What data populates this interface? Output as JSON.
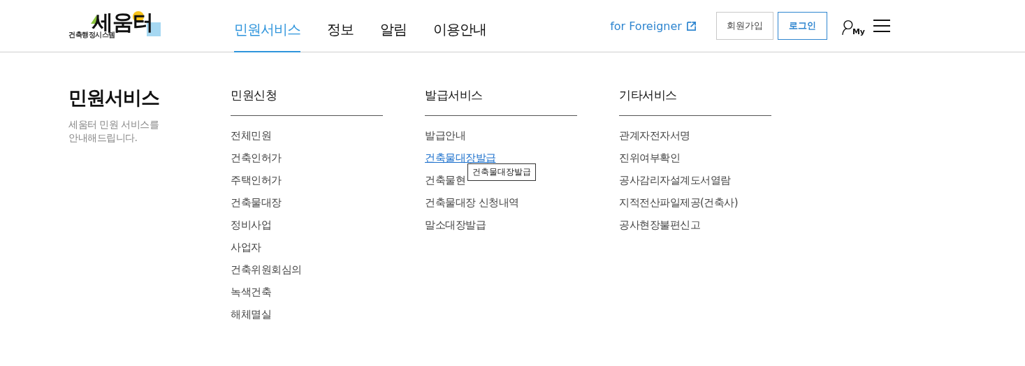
{
  "logo": {
    "name": "세움터",
    "subtitle": "건축행정시스템"
  },
  "nav": [
    {
      "label": "민원서비스",
      "selected": true
    },
    {
      "label": "정보",
      "selected": false
    },
    {
      "label": "알림",
      "selected": false
    },
    {
      "label": "이용안내",
      "selected": false
    }
  ],
  "utility": {
    "foreigner_link": "for Foreigner",
    "signup": "회원가입",
    "login": "로그인",
    "my_label": "My"
  },
  "menu": {
    "title": "민원서비스",
    "description": "세움터 민원 서비스를\n안내해드립니다.",
    "columns": [
      {
        "heading": "민원신청",
        "items": [
          {
            "label": "전체민원",
            "highlighted": false
          },
          {
            "label": "건축인허가",
            "highlighted": false
          },
          {
            "label": "주택인허가",
            "highlighted": false
          },
          {
            "label": "건축물대장",
            "highlighted": false
          },
          {
            "label": "정비사업",
            "highlighted": false
          },
          {
            "label": "사업자",
            "highlighted": false
          },
          {
            "label": "건축위원회심의",
            "highlighted": false
          },
          {
            "label": "녹색건축",
            "highlighted": false
          },
          {
            "label": "해체멸실",
            "highlighted": false
          }
        ]
      },
      {
        "heading": "발급서비스",
        "items": [
          {
            "label": "발급안내",
            "highlighted": false
          },
          {
            "label": "건축물대장발급",
            "highlighted": true,
            "tooltip": "건축물대장발급"
          },
          {
            "label": "건축물현",
            "highlighted": false
          },
          {
            "label": "건축물대장 신청내역",
            "highlighted": false
          },
          {
            "label": "말소대장발급",
            "highlighted": false
          }
        ]
      },
      {
        "heading": "기타서비스",
        "items": [
          {
            "label": "관계자전자서명",
            "highlighted": false
          },
          {
            "label": "진위여부확인",
            "highlighted": false
          },
          {
            "label": "공사감리자설계도서열람",
            "highlighted": false
          },
          {
            "label": "지적전산파일제공(건축사)",
            "highlighted": false
          },
          {
            "label": "공사현장불편신고",
            "highlighted": false
          }
        ]
      }
    ]
  }
}
